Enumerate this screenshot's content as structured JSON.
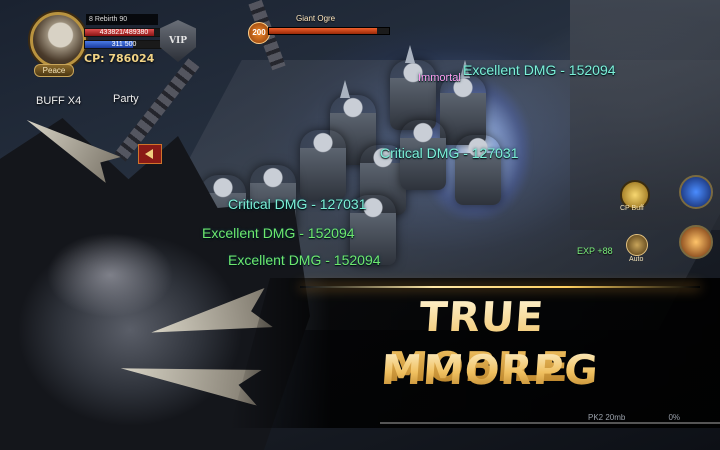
{
  "player": {
    "rebirth": "8 Rebirth 90",
    "hp": "433821/489380",
    "mp": "311 500",
    "cp_label": "CP: 786024",
    "peace_label": "Peace",
    "vip_label": "VIP",
    "hp_fraction": 0.89,
    "mp_fraction": 0.62
  },
  "hud": {
    "buff_label": "BUFF X4",
    "party_label": "Party",
    "cp_buff_label": "CP Buff",
    "auto_label": "Auto",
    "exp_text": "EXP +88"
  },
  "target": {
    "level": "200",
    "name": "Giant Ogre",
    "hp_fraction": 0.9
  },
  "damage_texts": [
    "Excellent DMG - 152094",
    "Critical DMG - 127031",
    "Critical DMG - 127031",
    "Excellent DMG - 152094",
    "Excellent DMG - 152094",
    "Immortal"
  ],
  "promo": {
    "line1": "TRUE MOBILE",
    "line2": "MMORPG"
  },
  "bottom": {
    "level_text": "PK2 20mb",
    "percent_text": "0%"
  },
  "colors": {
    "gold": "#f0c060",
    "damage_cyan": "#7cf0d8",
    "damage_green": "#6ee86e",
    "hp_red": "#e05050",
    "mp_blue": "#4a7be6"
  }
}
